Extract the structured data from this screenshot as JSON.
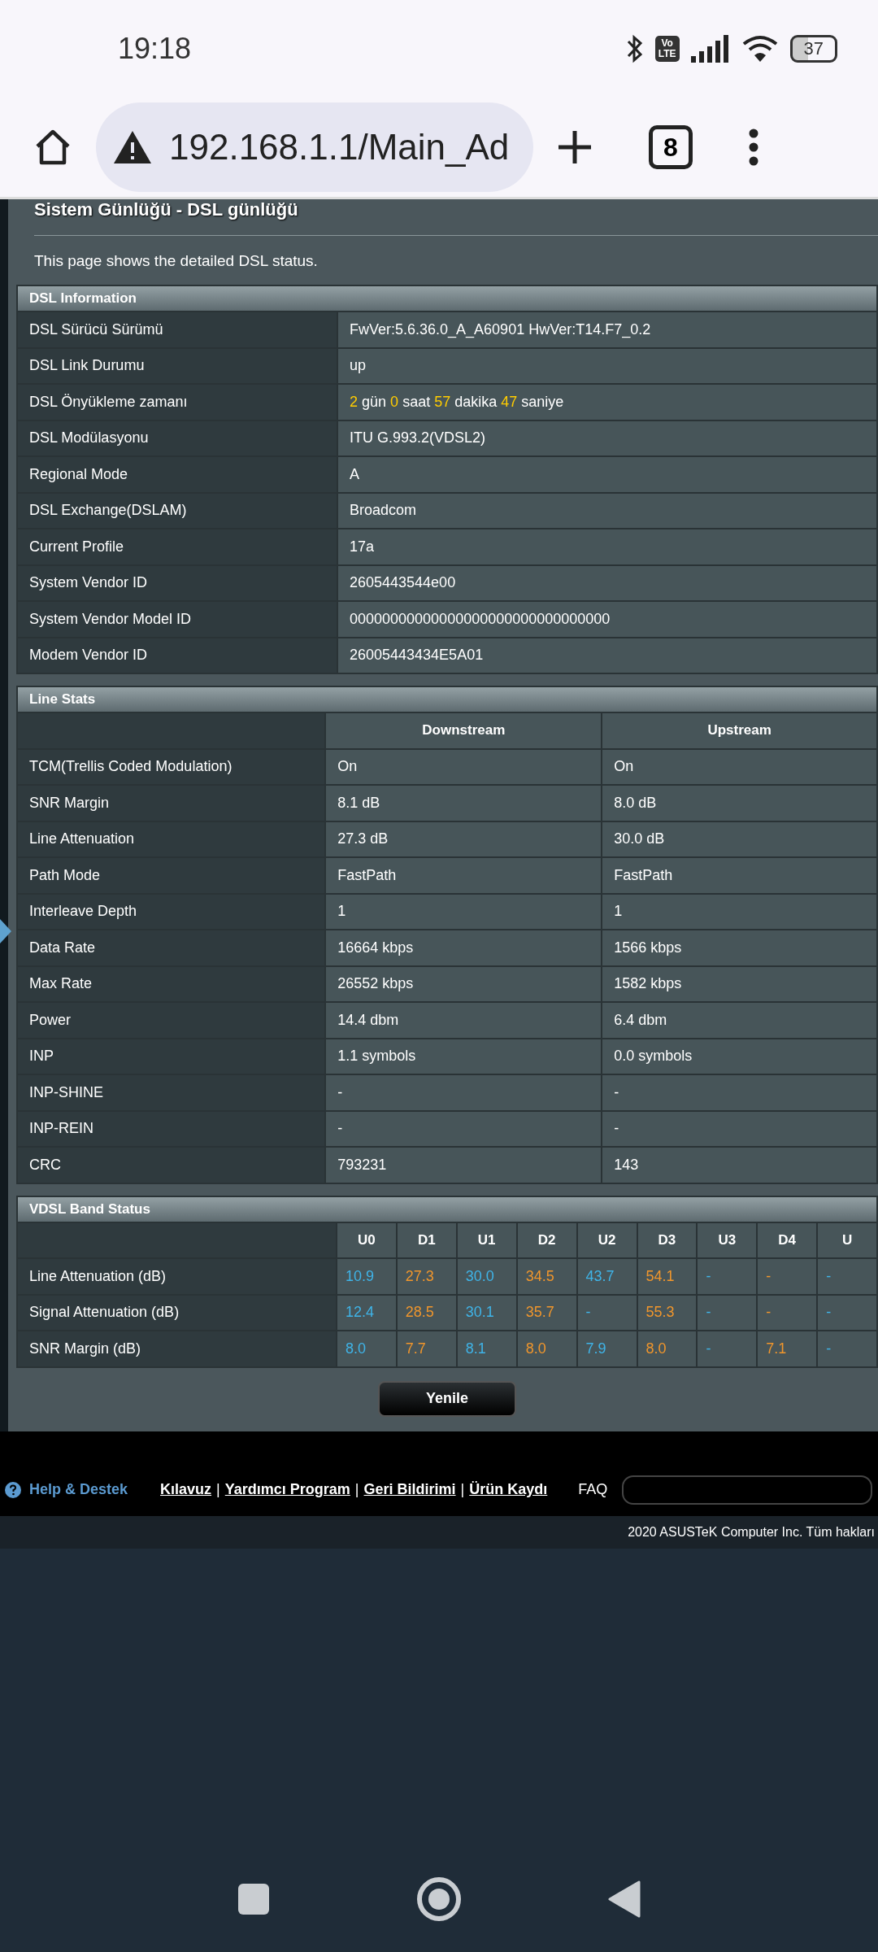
{
  "status_bar": {
    "time": "19:18",
    "network_badge": [
      "Vo",
      "LTE"
    ],
    "battery": "37"
  },
  "browser": {
    "url": "192.168.1.1/Main_Ad",
    "tab_count": "8"
  },
  "page": {
    "title": "Sistem Günlüğü - DSL günlüğü",
    "description": "This page shows the detailed DSL status.",
    "dsl_information": {
      "title": "DSL Information",
      "rows": [
        {
          "label": "DSL Sürücü Sürümü",
          "value": "FwVer:5.6.36.0_A_A60901 HwVer:T14.F7_0.2"
        },
        {
          "label": "DSL Link Durumu",
          "value": "up"
        },
        {
          "label": "DSL Önyükleme zamanı",
          "parts": [
            {
              "text": "2",
              "highlight": true
            },
            {
              "text": "gün",
              "highlight": false
            },
            {
              "text": "0",
              "highlight": true
            },
            {
              "text": "saat",
              "highlight": false
            },
            {
              "text": "57",
              "highlight": true
            },
            {
              "text": "dakika",
              "highlight": false
            },
            {
              "text": "47",
              "highlight": true
            },
            {
              "text": "saniye",
              "highlight": false
            }
          ]
        },
        {
          "label": "DSL Modülasyonu",
          "value": "ITU G.993.2(VDSL2)"
        },
        {
          "label": "Regional Mode",
          "value": "A"
        },
        {
          "label": "DSL Exchange(DSLAM)",
          "value": "Broadcom"
        },
        {
          "label": "Current Profile",
          "value": "17a"
        },
        {
          "label": "System Vendor ID",
          "value": "2605443544e00"
        },
        {
          "label": "System Vendor Model ID",
          "value": "00000000000000000000000000000000"
        },
        {
          "label": "Modem Vendor ID",
          "value": "26005443434E5A01"
        }
      ]
    },
    "line_stats": {
      "title": "Line Stats",
      "columns": [
        "Downstream",
        "Upstream"
      ],
      "rows": [
        {
          "label": "TCM(Trellis Coded Modulation)",
          "values": [
            "On",
            "On"
          ]
        },
        {
          "label": "SNR Margin",
          "values": [
            "8.1 dB",
            "8.0 dB"
          ]
        },
        {
          "label": "Line Attenuation",
          "values": [
            "27.3 dB",
            "30.0 dB"
          ]
        },
        {
          "label": "Path Mode",
          "values": [
            "FastPath",
            "FastPath"
          ]
        },
        {
          "label": "Interleave Depth",
          "values": [
            "1",
            "1"
          ]
        },
        {
          "label": "Data Rate",
          "values": [
            "16664 kbps",
            "1566 kbps"
          ]
        },
        {
          "label": "Max Rate",
          "values": [
            "26552 kbps",
            "1582 kbps"
          ]
        },
        {
          "label": "Power",
          "values": [
            "14.4 dbm",
            "6.4 dbm"
          ]
        },
        {
          "label": "INP",
          "values": [
            "1.1 symbols",
            "0.0 symbols"
          ]
        },
        {
          "label": "INP-SHINE",
          "values": [
            "-",
            "-"
          ]
        },
        {
          "label": "INP-REIN",
          "values": [
            "-",
            "-"
          ]
        },
        {
          "label": "CRC",
          "values": [
            "793231",
            "143"
          ]
        }
      ]
    },
    "vdsl_band_status": {
      "title": "VDSL Band Status",
      "columns": [
        {
          "label": "U0",
          "color": "#3fb4e8"
        },
        {
          "label": "D1",
          "color": "#f0962c"
        },
        {
          "label": "U1",
          "color": "#3fb4e8"
        },
        {
          "label": "D2",
          "color": "#f0962c"
        },
        {
          "label": "U2",
          "color": "#3fb4e8"
        },
        {
          "label": "D3",
          "color": "#f0962c"
        },
        {
          "label": "U3",
          "color": "#3fb4e8"
        },
        {
          "label": "D4",
          "color": "#f0962c"
        },
        {
          "label": "U",
          "color": "#3fb4e8"
        }
      ],
      "rows": [
        {
          "label": "Line Attenuation (dB)",
          "values": [
            "10.9",
            "27.3",
            "30.0",
            "34.5",
            "43.7",
            "54.1",
            "-",
            "-",
            "-"
          ]
        },
        {
          "label": "Signal Attenuation (dB)",
          "values": [
            "12.4",
            "28.5",
            "30.1",
            "35.7",
            "-",
            "55.3",
            "-",
            "-",
            "-"
          ]
        },
        {
          "label": "SNR Margin (dB)",
          "values": [
            "8.0",
            "7.7",
            "8.1",
            "8.0",
            "7.9",
            "8.0",
            "-",
            "7.1",
            "-"
          ]
        }
      ]
    },
    "refresh_button": "Yenile"
  },
  "footer": {
    "help": "Help & Destek",
    "links": [
      "Kılavuz",
      "Yardımcı Program",
      "Geri Bildirimi",
      "Ürün Kaydı"
    ],
    "separator": "|",
    "faq": "FAQ",
    "copyright": "2020 ASUSTeK Computer Inc. Tüm hakları"
  }
}
